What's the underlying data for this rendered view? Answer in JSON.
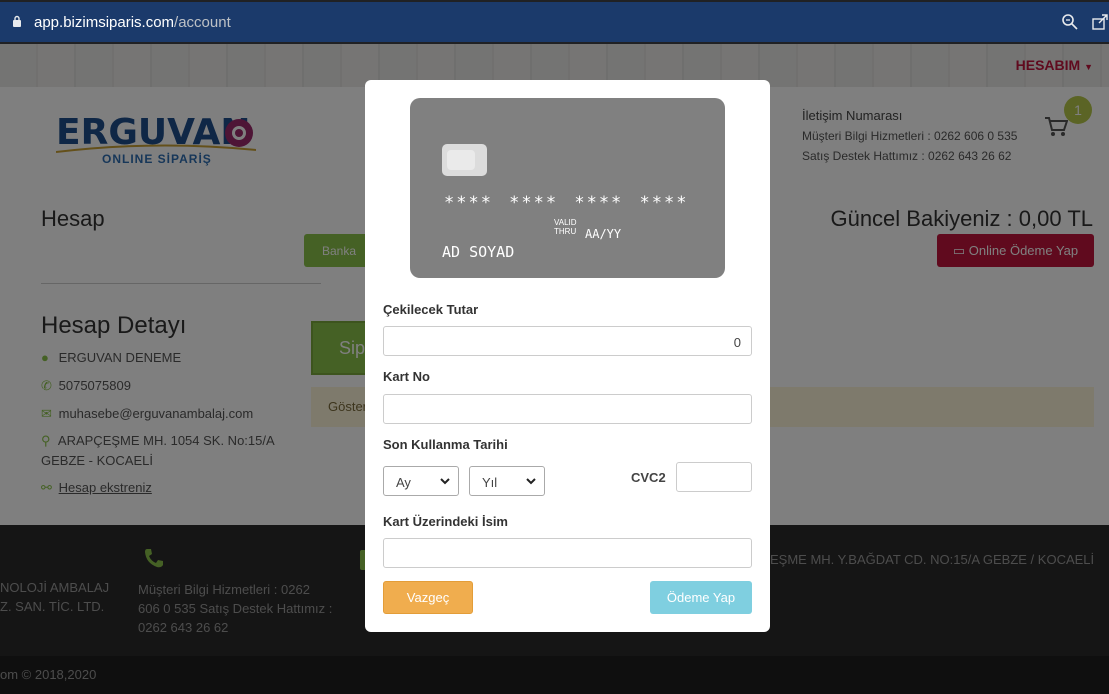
{
  "browser": {
    "url_domain": "app.bizimsiparis.com",
    "url_path": "/account"
  },
  "header": {
    "account_menu": "HESABIM",
    "logo_text": "ERGUVAN",
    "logo_subtext": "ONLINE SİPARİŞ",
    "contact_title": "İletişim Numarası",
    "contact_line1": "Müşteri Bilgi Hizmetleri : 0262 606 0 535",
    "contact_line2": "Satış Destek Hattımız : 0262 643 26 62",
    "cart_count": "1"
  },
  "account": {
    "title": "Hesap",
    "balance": "Güncel Bakiyeniz : 0,00 TL",
    "bank_button": "Banka",
    "online_payment_button": "Online Ödeme Yap",
    "detail_title": "Hesap Detayı",
    "name": "ERGUVAN DENEME",
    "phone": "5075075809",
    "email": "muhasebe@erguvanambalaj.com",
    "address_line1": "ARAPÇEŞME MH. 1054 SK. No:15/A",
    "address_line2": "GEBZE - KOCAELİ",
    "statement_link": "Hesap ekstreniz",
    "orders_button": "Sipa",
    "notice_text": "Göster"
  },
  "footer": {
    "company_line1": "NOLOJİ AMBALAJ",
    "company_line2": "Z. SAN. TİC. LTD.",
    "phone_text_line1": "Müşteri Bilgi Hizmetleri : 0262",
    "phone_text_line2": "606 0 535 Satış Destek Hattımız :",
    "phone_text_line3": "0262 643 26 62",
    "address_text": "EŞME MH. Y.BAĞDAT CD. NO:15/A GEBZE / KOCAELİ",
    "copyright": "om © 2018,2020"
  },
  "modal": {
    "card": {
      "number_mask": "**** **** **** ****",
      "valid_label_1": "VALID",
      "valid_label_2": "THRU",
      "expiry_placeholder": "AA/YY",
      "holder_placeholder": "AD SOYAD"
    },
    "amount_label": "Çekilecek Tutar",
    "amount_value": "0",
    "card_no_label": "Kart No",
    "expiry_label": "Son Kullanma Tarihi",
    "month_select": "Ay",
    "year_select": "Yıl",
    "cvc_label": "CVC2",
    "name_label": "Kart Üzerindeki İsim",
    "cancel_button": "Vazgeç",
    "pay_button": "Ödeme Yap"
  },
  "colors": {
    "brand_red": "#c0143c",
    "brand_green": "#8bc34a",
    "card_gray": "#808080",
    "cancel_orange": "#f0ad4e",
    "pay_blue": "#7fcfe0"
  }
}
